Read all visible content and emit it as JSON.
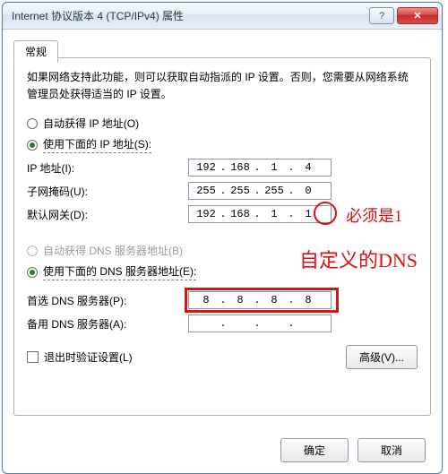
{
  "window": {
    "title": "Internet 协议版本 4 (TCP/IPv4) 属性"
  },
  "tab": {
    "general": "常规"
  },
  "intro": "如果网络支持此功能，则可以获取自动指派的 IP 设置。否则，您需要从网络系统管理员处获得适当的 IP 设置。",
  "ip": {
    "auto": "自动获得 IP 地址(O)",
    "manual": "使用下面的 IP 地址(S):",
    "addr_label": "IP 地址(I):",
    "mask_label": "子网掩码(U):",
    "gw_label": "默认网关(D):",
    "addr": [
      "192",
      "168",
      "1",
      "4"
    ],
    "mask": [
      "255",
      "255",
      "255",
      "0"
    ],
    "gw": [
      "192",
      "168",
      "1",
      "1"
    ]
  },
  "dns": {
    "auto": "自动获得 DNS 服务器地址(B)",
    "manual": "使用下面的 DNS 服务器地址(E):",
    "pref_label": "首选 DNS 服务器(P):",
    "alt_label": "备用 DNS 服务器(A):",
    "pref": [
      "8",
      "8",
      "8",
      "8"
    ],
    "alt": [
      "",
      "",
      "",
      ""
    ]
  },
  "validate": "退出时验证设置(L)",
  "advanced": "高级(V)...",
  "buttons": {
    "ok": "确定",
    "cancel": "取消"
  },
  "annotations": {
    "must_be_1": "必须是1",
    "custom_dns": "自定义的DNS"
  },
  "ip_dot": "."
}
